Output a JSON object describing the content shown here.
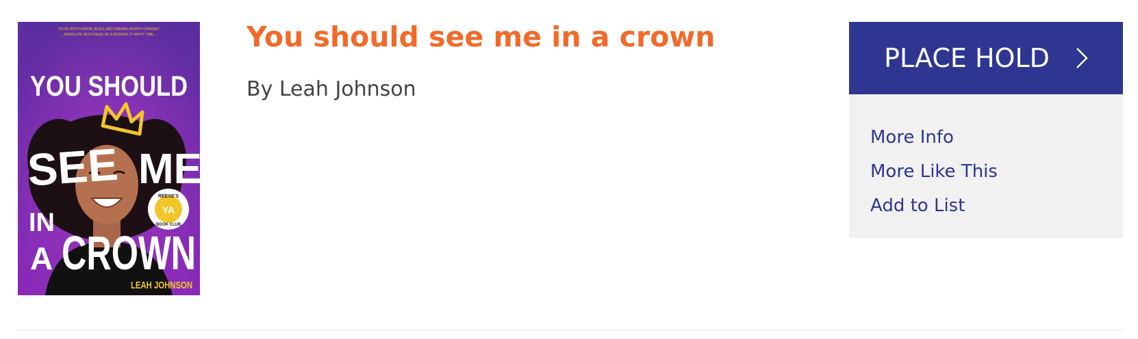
{
  "book": {
    "title": "You should see me in a crown",
    "author_line": "By Leah Johnson"
  },
  "cover": {
    "title_words": [
      "YOU SHOULD",
      "SEE",
      "ME",
      "IN",
      "A",
      "CROWN"
    ],
    "author_text": "LEAH JOHNSON",
    "badge_line1": "REESE'S",
    "badge_line2": "YA",
    "badge_line3": "BOOK CLUB",
    "blurb_line1": "\"SLICE WITH HUMOR, BLISS, AND DREAMS WORTH CHASING\"",
    "blurb_line2": "...ABSOLUTE MUST-READ OF A MODERN IT HAPPY TIME...",
    "colors": {
      "background_top": "#5a2e9e",
      "background_bottom": "#8a2ab8",
      "crown": "#f2c62a",
      "text": "#ffffff"
    }
  },
  "actions": {
    "place_hold": "PLACE HOLD",
    "links": [
      "More Info",
      "More Like This",
      "Add to List"
    ]
  },
  "colors": {
    "title": "#f26a2a",
    "accent": "#2e3691",
    "panel": "#f1f1f1"
  },
  "icons": {
    "place_hold": "chevron-right-icon"
  }
}
